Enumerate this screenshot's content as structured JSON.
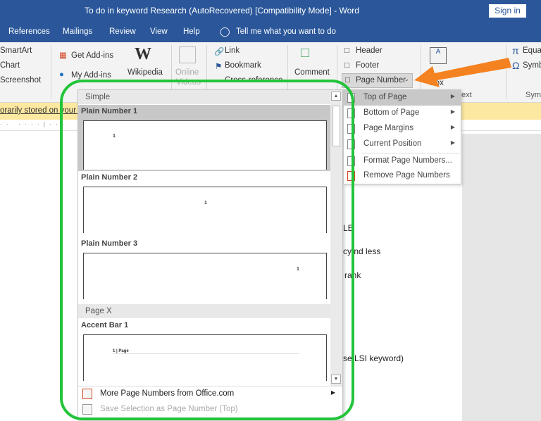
{
  "window": {
    "title": "To do in keyword Research (AutoRecovered) [Compatibility Mode]  -  Word",
    "sign_in": "Sign in"
  },
  "tabs": [
    "References",
    "Mailings",
    "Review",
    "View",
    "Help"
  ],
  "tell_me": "Tell me what you want to do",
  "ribbon": {
    "smartart": "SmartArt",
    "chart": "Chart",
    "screenshot": "Screenshot",
    "get_addins": "Get Add-ins",
    "my_addins": "My Add-ins",
    "wikipedia": "Wikipedia",
    "online_videos": "Online",
    "videos": "Videos",
    "link": "Link",
    "bookmark": "Bookmark",
    "cross_reference": "Cross-reference",
    "comment": "Comment",
    "header": "Header",
    "footer": "Footer",
    "page_number": "Page Number",
    "text_box": "Box",
    "group_text": "ext",
    "equation": "Equa",
    "symbol": "Symb",
    "group_symbols": "Symb"
  },
  "message_bar": "orarily stored on your c",
  "document": {
    "lines": [
      "LE",
      "cy nd less",
      "rank",
      "se LSI keyword)"
    ]
  },
  "gallery": {
    "sections": [
      {
        "header": "Simple",
        "items": [
          {
            "label": "Plain Number 1",
            "preview": "1"
          },
          {
            "label": "Plain Number 2",
            "preview": "1"
          },
          {
            "label": "Plain Number 3",
            "preview": "1"
          }
        ]
      },
      {
        "header": "Page X",
        "items": [
          {
            "label": "Accent Bar 1",
            "preview": "1 | Page"
          }
        ]
      }
    ],
    "footer": [
      {
        "label": "More Page Numbers from Office.com",
        "enabled": true
      },
      {
        "label": "Save Selection as Page Number (Top)",
        "enabled": false
      }
    ]
  },
  "submenu": [
    {
      "label": "Top of Page",
      "has_sub": true,
      "highlighted": true
    },
    {
      "label": "Bottom of Page",
      "has_sub": true
    },
    {
      "label": "Page Margins",
      "has_sub": true
    },
    {
      "label": "Current Position",
      "has_sub": true
    },
    {
      "label": "Format Page Numbers...",
      "has_sub": false
    },
    {
      "label": "Remove Page Numbers",
      "has_sub": false
    }
  ],
  "colors": {
    "title_bar": "#2b579a",
    "highlight_ring": "#22c43a",
    "arrow": "#f58220",
    "message_bar": "#fde8a1"
  }
}
